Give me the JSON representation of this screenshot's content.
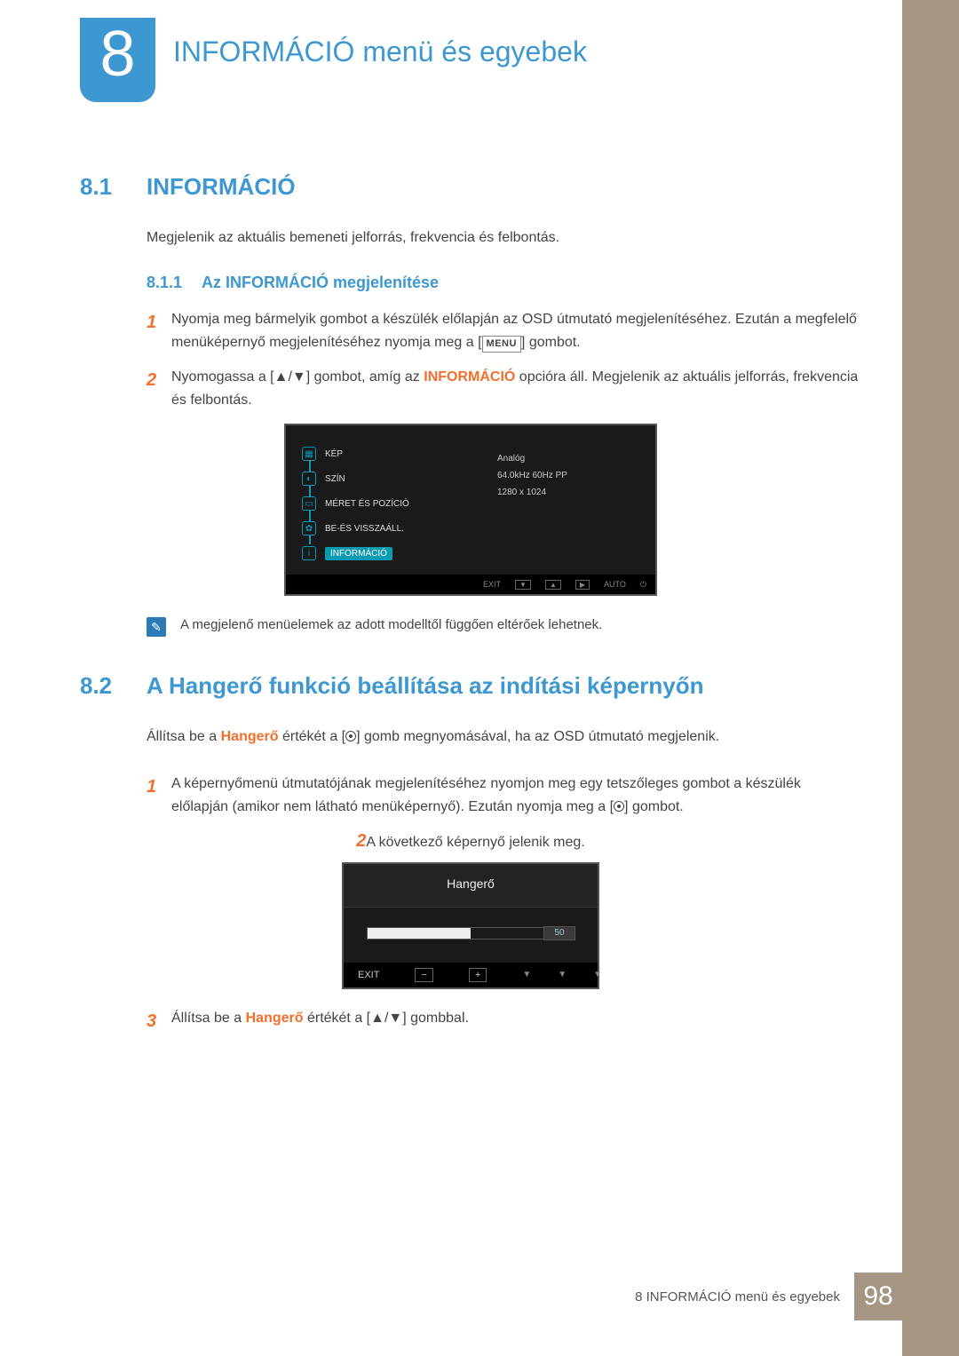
{
  "chapter": {
    "number": "8",
    "title": "INFORMÁCIÓ menü és egyebek"
  },
  "section1": {
    "num": "8.1",
    "title": "INFORMÁCIÓ",
    "intro": "Megjelenik az aktuális bemeneti jelforrás, frekvencia és felbontás.",
    "sub": {
      "num": "8.1.1",
      "title": "Az INFORMÁCIÓ megjelenítése"
    },
    "step1": {
      "n": "1",
      "a": "Nyomja meg bármelyik gombot a készülék előlapján az OSD útmutató megjelenítéséhez. Ezután a megfelelő menüképernyő megjelenítéséhez nyomja meg a [",
      "key": "MENU",
      "b": "] gombot."
    },
    "step2": {
      "n": "2",
      "a": "Nyomogassa a [",
      "arrows": "▲/▼",
      "b": "] gombot, amíg az ",
      "kw": "INFORMÁCIÓ",
      "c": " opcióra áll. Megjelenik az aktuális jelforrás, frekvencia és felbontás."
    },
    "osd": {
      "items": [
        "KÉP",
        "SZÍN",
        "MÉRET ÉS POZÍCIÓ",
        "BE-ÉS VISSZAÁLL.",
        "INFORMÁCIÓ"
      ],
      "info": [
        "Analóg",
        "64.0kHz 60Hz PP",
        "1280 x 1024"
      ],
      "footer": {
        "exit": "EXIT",
        "auto": "AUTO"
      }
    },
    "note": "A megjelenő menüelemek az adott modelltől függően eltérőek lehetnek."
  },
  "section2": {
    "num": "8.2",
    "title": "A Hangerő funkció beállítása az indítási képernyőn",
    "intro": {
      "a": "Állítsa be a ",
      "kw": "Hangerő",
      "b": " értékét a [",
      "c": "] gomb megnyomásával, ha az OSD útmutató megjelenik."
    },
    "step1": {
      "n": "1",
      "a": "A képernyőmenü útmutatójának megjelenítéséhez nyomjon meg egy tetszőleges gombot a készülék előlapján (amikor nem látható menüképernyő). Ezután nyomja meg a [",
      "b": "] gombot."
    },
    "step2": {
      "n": "2",
      "text": "A következő képernyő jelenik meg."
    },
    "osd": {
      "title": "Hangerő",
      "value": "50",
      "exit": "EXIT"
    },
    "step3": {
      "n": "3",
      "a": "Állítsa be a ",
      "kw": "Hangerő",
      "b": " értékét a [",
      "arrows": "▲/▼",
      "c": "] gombbal."
    }
  },
  "footer": {
    "text": "8 INFORMÁCIÓ menü és egyebek",
    "page": "98"
  }
}
